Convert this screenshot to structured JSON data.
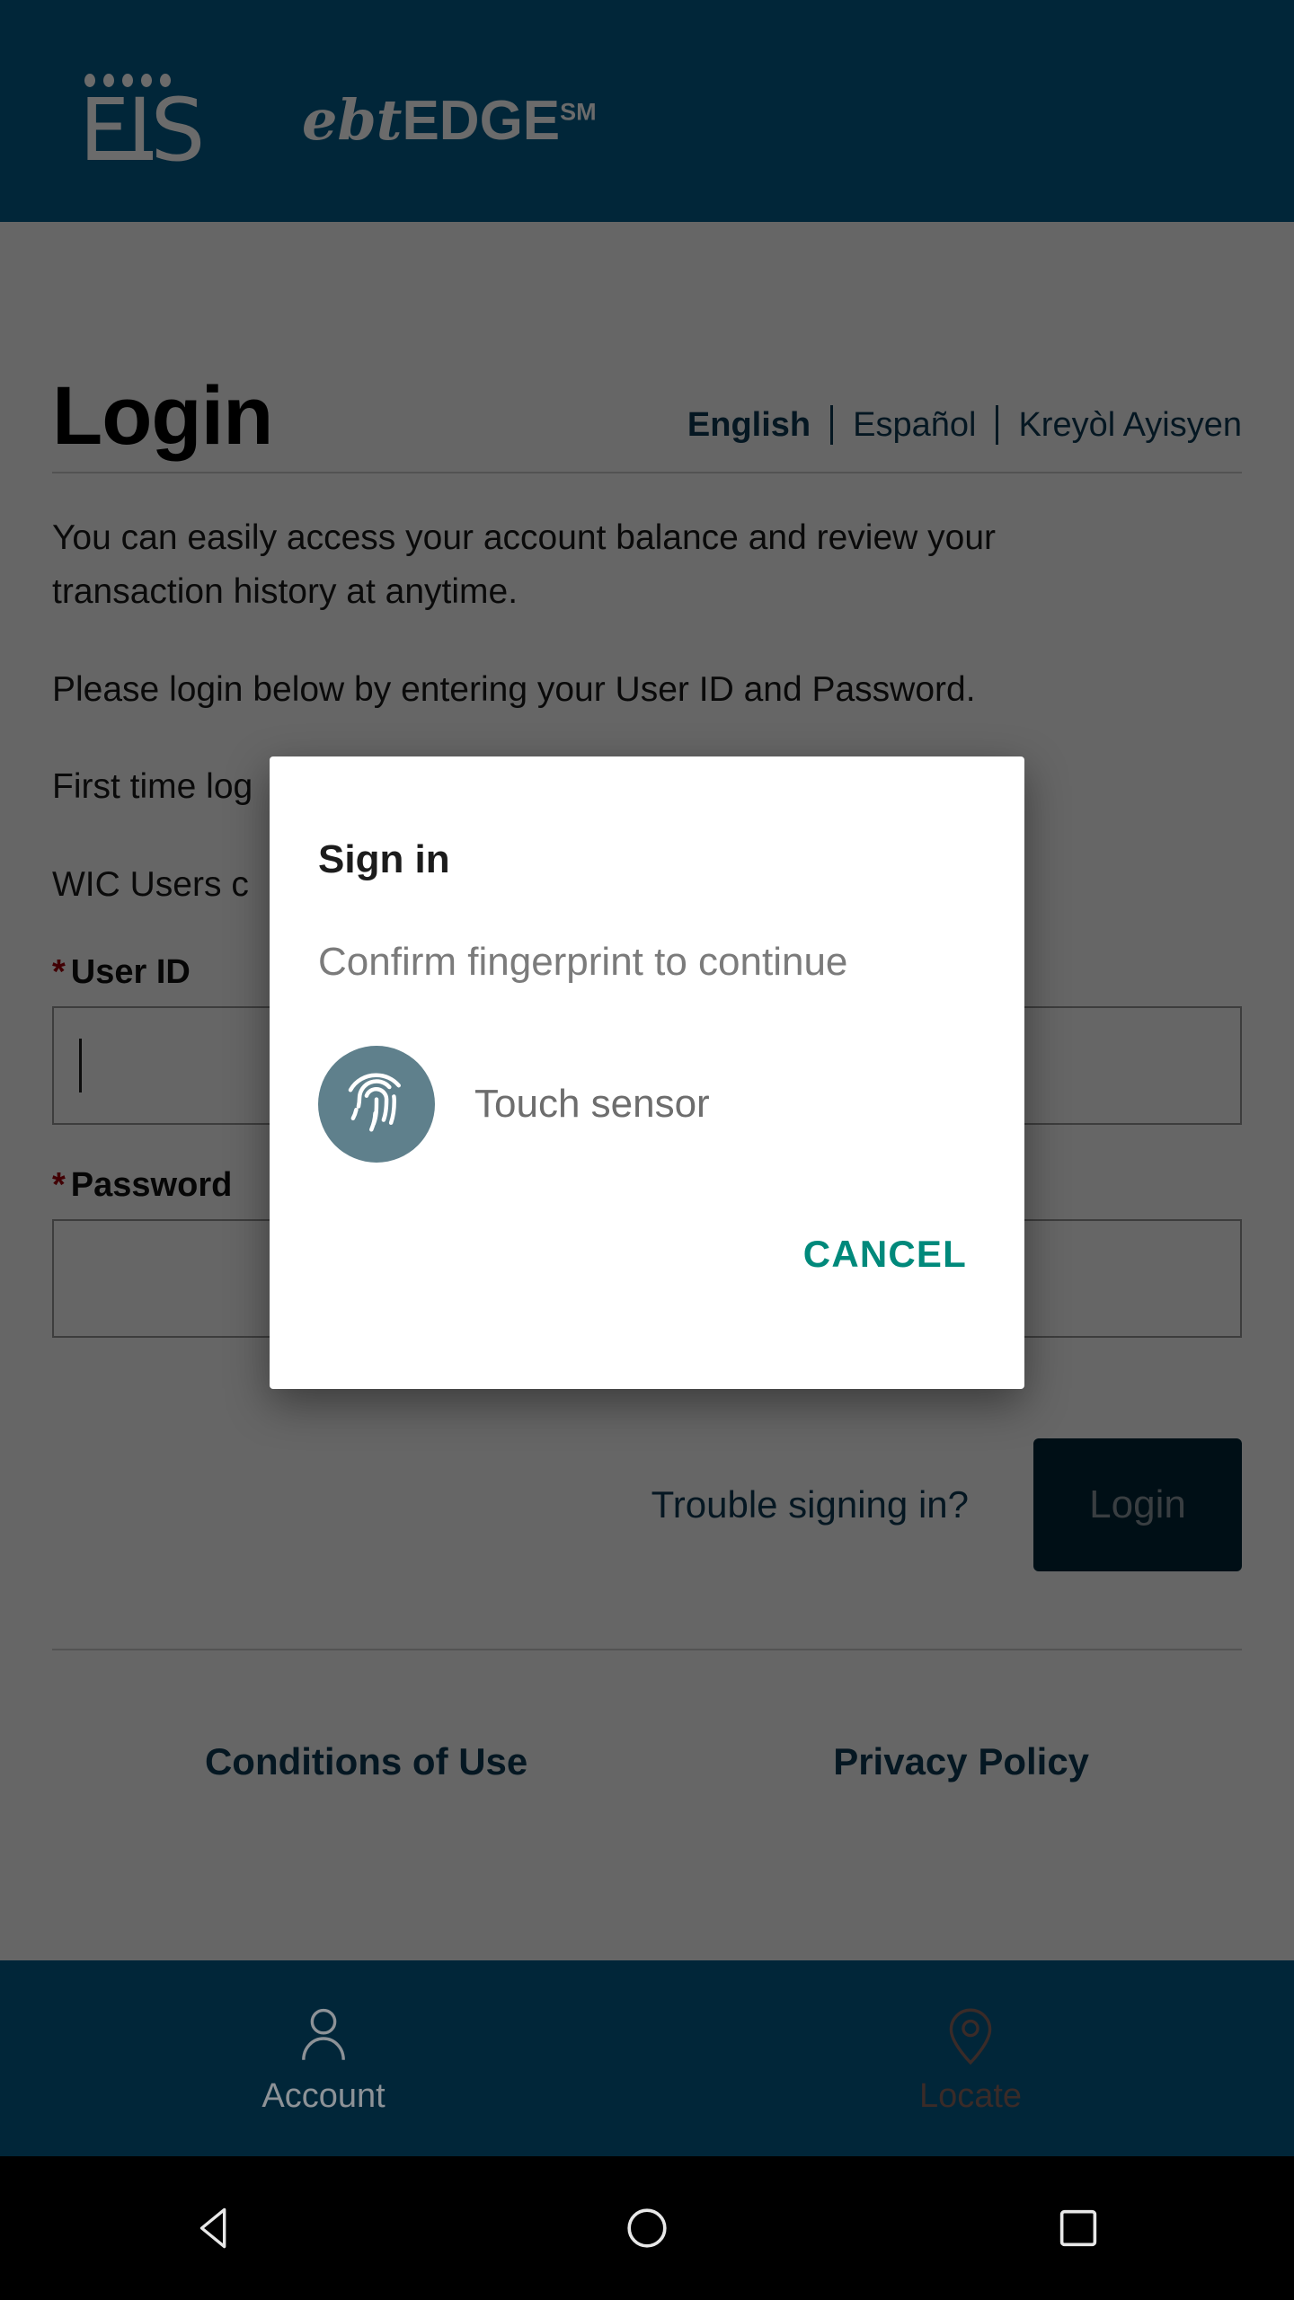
{
  "header": {
    "brand_fis": "FIS",
    "brand_product_italic": "ebt",
    "brand_product_bold": "EDGE",
    "brand_product_sm": "SM",
    "background_color": "#012639",
    "logo_color": "#6b6b6b"
  },
  "page": {
    "title": "Login",
    "languages": [
      {
        "label": "English",
        "active": true
      },
      {
        "label": "Español",
        "active": false
      },
      {
        "label": "Kreyòl Ayisyen",
        "active": false
      }
    ],
    "paragraphs": [
      "You can easily access your account balance and review your transaction history at anytime.",
      "Please login below by entering your User ID and Password.",
      "First time log",
      "WIC Users c"
    ],
    "fields": [
      {
        "required_mark": "*",
        "label": "User ID",
        "value": "",
        "placeholder": "",
        "focused": true
      },
      {
        "required_mark": "*",
        "label": "Password",
        "value": "",
        "placeholder": "",
        "focused": false
      }
    ],
    "trouble_link": "Trouble signing in?",
    "login_button": "Login",
    "footer_links": [
      "Conditions of Use",
      "Privacy Policy"
    ],
    "link_color": "#0d3b55",
    "required_color": "#a4000b"
  },
  "dialog": {
    "title": "Sign in",
    "subtitle": "Confirm fingerprint to continue",
    "sensor_label": "Touch sensor",
    "cancel_label": "CANCEL",
    "icon_name": "fingerprint-icon",
    "icon_circle_color": "#5f808c",
    "cancel_color": "#00897b"
  },
  "tab_bar": {
    "background_color": "#012639",
    "tabs": [
      {
        "label": "Account",
        "icon": "person-icon",
        "active": true
      },
      {
        "label": "Locate",
        "icon": "map-pin-icon",
        "active": false
      }
    ]
  },
  "nav_bar": {
    "buttons": [
      {
        "name": "back-button",
        "icon": "triangle-left-icon"
      },
      {
        "name": "home-button",
        "icon": "circle-icon"
      },
      {
        "name": "recents-button",
        "icon": "square-icon"
      }
    ]
  }
}
